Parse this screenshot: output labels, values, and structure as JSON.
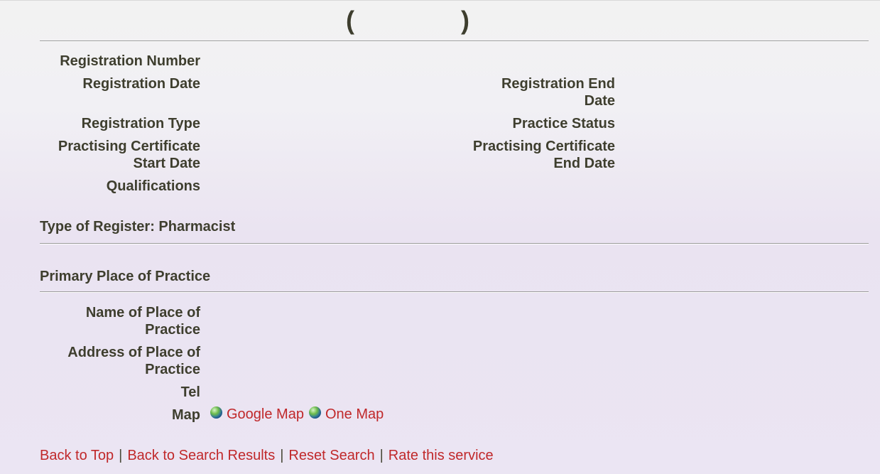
{
  "header": {
    "paren_open": "(",
    "paren_close": ")"
  },
  "fields_left": {
    "registration_number": "Registration Number",
    "registration_date": "Registration Date",
    "registration_type": "Registration Type",
    "practising_cert_start_l1": "Practising Certificate",
    "practising_cert_start_l2": "Start Date",
    "qualifications": "Qualifications"
  },
  "fields_right": {
    "registration_end_l1": "Registration End",
    "registration_end_l2": "Date",
    "practice_status": "Practice Status",
    "practising_cert_end_l1": "Practising Certificate",
    "practising_cert_end_l2": "End Date"
  },
  "register_type": "Type of Register: Pharmacist",
  "primary_place": {
    "heading": "Primary Place of Practice",
    "name_l1": "Name of Place of",
    "name_l2": "Practice",
    "address_l1": "Address of Place of",
    "address_l2": "Practice",
    "tel": "Tel",
    "map": "Map",
    "google_map": "Google Map",
    "one_map": "One Map"
  },
  "footer": {
    "back_to_top": "Back to Top",
    "back_to_results": "Back to Search Results",
    "reset_search": "Reset Search",
    "rate_service": "Rate this service",
    "separator": "|"
  },
  "colors": {
    "link": "#c0282a",
    "label": "#3e3e2e"
  },
  "icons": {
    "map_icon": "globe-icon"
  }
}
